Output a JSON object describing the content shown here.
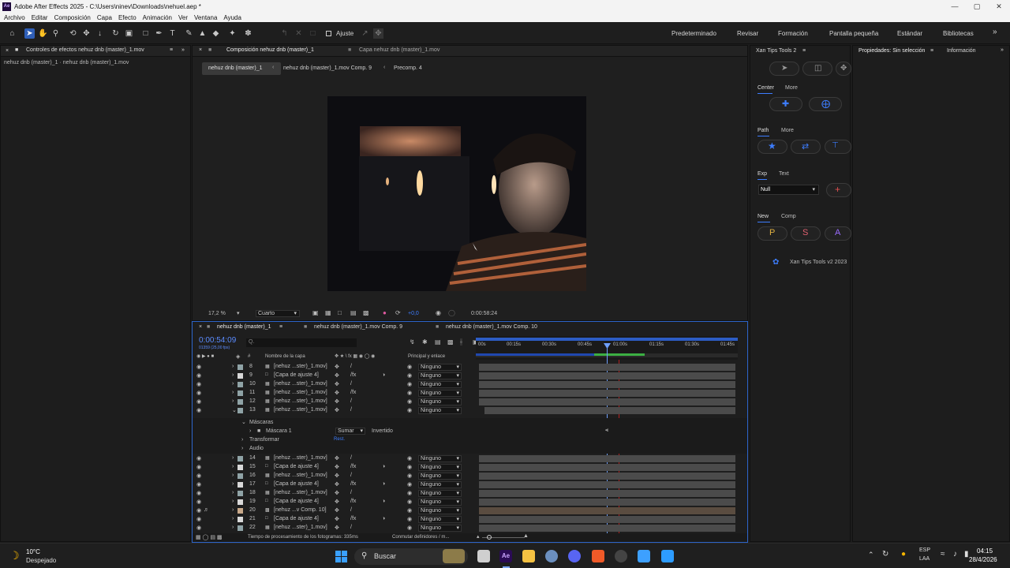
{
  "app": {
    "title": "Adobe After Effects 2025 - C:\\Users\\ninev\\Downloads\\nehuel.aep *",
    "logo": "Ae",
    "menu": [
      "Archivo",
      "Editar",
      "Composición",
      "Capa",
      "Efecto",
      "Animación",
      "Ver",
      "Ventana",
      "Ayuda"
    ]
  },
  "toolbar": {
    "tools": [
      "home-icon",
      "selection-icon",
      "hand-icon",
      "zoom-icon",
      "orbit-icon",
      "pan-icon",
      "dolly-icon",
      "rotate-icon",
      "camera-icon",
      "rect-mask-icon",
      "pen-icon",
      "text-icon",
      "brush-icon",
      "clone-icon",
      "eraser-icon",
      "roto-icon",
      "puppet-icon"
    ],
    "snap_label": "Ajuste",
    "workspaces": [
      "Predeterminado",
      "Revisar",
      "Formación",
      "Pantalla pequeña",
      "Estándar",
      "Bibliotecas"
    ]
  },
  "left_panel": {
    "tab": "Controles de efectos nehuz dnb (master)_1.mov",
    "subtitle": "nehuz dnb (master)_1 · nehuz dnb (master)_1.mov"
  },
  "comp_panel": {
    "tabs": [
      "Composición nehuz dnb (master)_1",
      "Capa nehuz dnb (master)_1.mov"
    ],
    "breadcrumbs": [
      "nehuz dnb (master)_1",
      "nehuz dnb (master)_1.mov Comp. 9",
      "Precomp. 4"
    ],
    "zoom": "17,2 %",
    "resolution": "Cuarto",
    "exposure": "+0,0",
    "timecode": "0:00:58:24"
  },
  "xan_panel": {
    "title": "Xan Tips Tools 2",
    "sections": [
      {
        "tabs": [
          "Center",
          "More"
        ]
      },
      {
        "tabs": [
          "Path",
          "More"
        ]
      },
      {
        "tabs": [
          "Exp",
          "Text"
        ],
        "select": "Null"
      },
      {
        "tabs": [
          "New",
          "Comp"
        ],
        "buttons": [
          "P",
          "S",
          "A"
        ]
      }
    ],
    "footer": "Xan Tips Tools v2 2023"
  },
  "right_panel": {
    "tabs": [
      "Propiedades: Sin selección",
      "Información"
    ]
  },
  "timeline": {
    "tabs": [
      "nehuz dnb (master)_1",
      "nehuz dnb (master)_1.mov Comp. 9",
      "nehuz dnb (master)_1.mov Comp. 10"
    ],
    "current_time": "0:00:54:09",
    "current_time_sub": "01359 (25,00 fps)",
    "search_placeholder": "Q.",
    "headers": {
      "name": "Nombre de la capa",
      "num": "#",
      "parent": "Principal y enlace"
    },
    "ruler": [
      "00s",
      "00:15s",
      "00:30s",
      "00:45s",
      "01:00s",
      "01:15s",
      "01:30s",
      "01:45s"
    ],
    "layers_top": [
      {
        "num": "8",
        "name": "[nehuz ...ster)_1.mov]",
        "parent": "Ninguno",
        "color": "#8fa3a6"
      },
      {
        "num": "9",
        "name": "[Capa de ajuste 4]",
        "parent": "Ninguno",
        "color": "#d8d8d8"
      },
      {
        "num": "10",
        "name": "[nehuz ...ster)_1.mov]",
        "parent": "Ninguno",
        "color": "#8fa3a6"
      },
      {
        "num": "11",
        "name": "[nehuz ...ster)_1.mov]",
        "parent": "Ninguno",
        "color": "#8fa3a6"
      },
      {
        "num": "12",
        "name": "[nehuz ...ster)_1.mov]",
        "parent": "Ninguno",
        "color": "#8fa3a6"
      },
      {
        "num": "13",
        "name": "[nehuz ...ster)_1.mov]",
        "parent": "Ninguno",
        "color": "#8fa3a6"
      }
    ],
    "expanded": {
      "masks": "Máscaras",
      "mask1": "Máscara 1",
      "mode": "Sumar",
      "inverted": "Invertido",
      "transform": "Transformar",
      "reset": "Rest.",
      "audio": "Audio"
    },
    "layers_bottom": [
      {
        "num": "14",
        "name": "[nehuz ...ster)_1.mov]",
        "parent": "Ninguno",
        "color": "#8fa3a6"
      },
      {
        "num": "15",
        "name": "[Capa de ajuste 4]",
        "parent": "Ninguno",
        "color": "#d8d8d8"
      },
      {
        "num": "16",
        "name": "[nehuz ...ster)_1.mov]",
        "parent": "Ninguno",
        "color": "#8fa3a6"
      },
      {
        "num": "17",
        "name": "[Capa de ajuste 4]",
        "parent": "Ninguno",
        "color": "#d8d8d8"
      },
      {
        "num": "18",
        "name": "[nehuz ...ster)_1.mov]",
        "parent": "Ninguno",
        "color": "#8fa3a6"
      },
      {
        "num": "19",
        "name": "[Capa de ajuste 4]",
        "parent": "Ninguno",
        "color": "#d8d8d8"
      },
      {
        "num": "20",
        "name": "[nehuz ...v Comp. 10]",
        "parent": "Ninguno",
        "color": "#c9a98a"
      },
      {
        "num": "21",
        "name": "[Capa de ajuste 4]",
        "parent": "Ninguno",
        "color": "#d8d8d8"
      },
      {
        "num": "22",
        "name": "[nehuz ...ster)_1.mov]",
        "parent": "Ninguno",
        "color": "#8fa3a6"
      }
    ],
    "footer_render": "Tiempo de procesamiento de los fotogramas: 335ms",
    "footer_toggle": "Conmutar definidores / m..."
  },
  "taskbar": {
    "weather_temp": "10°C",
    "weather_desc": "Despejado",
    "search": "Buscar",
    "lang1": "ESP",
    "lang2": "LAA",
    "time": "04:15",
    "date": "28/4/2026"
  }
}
